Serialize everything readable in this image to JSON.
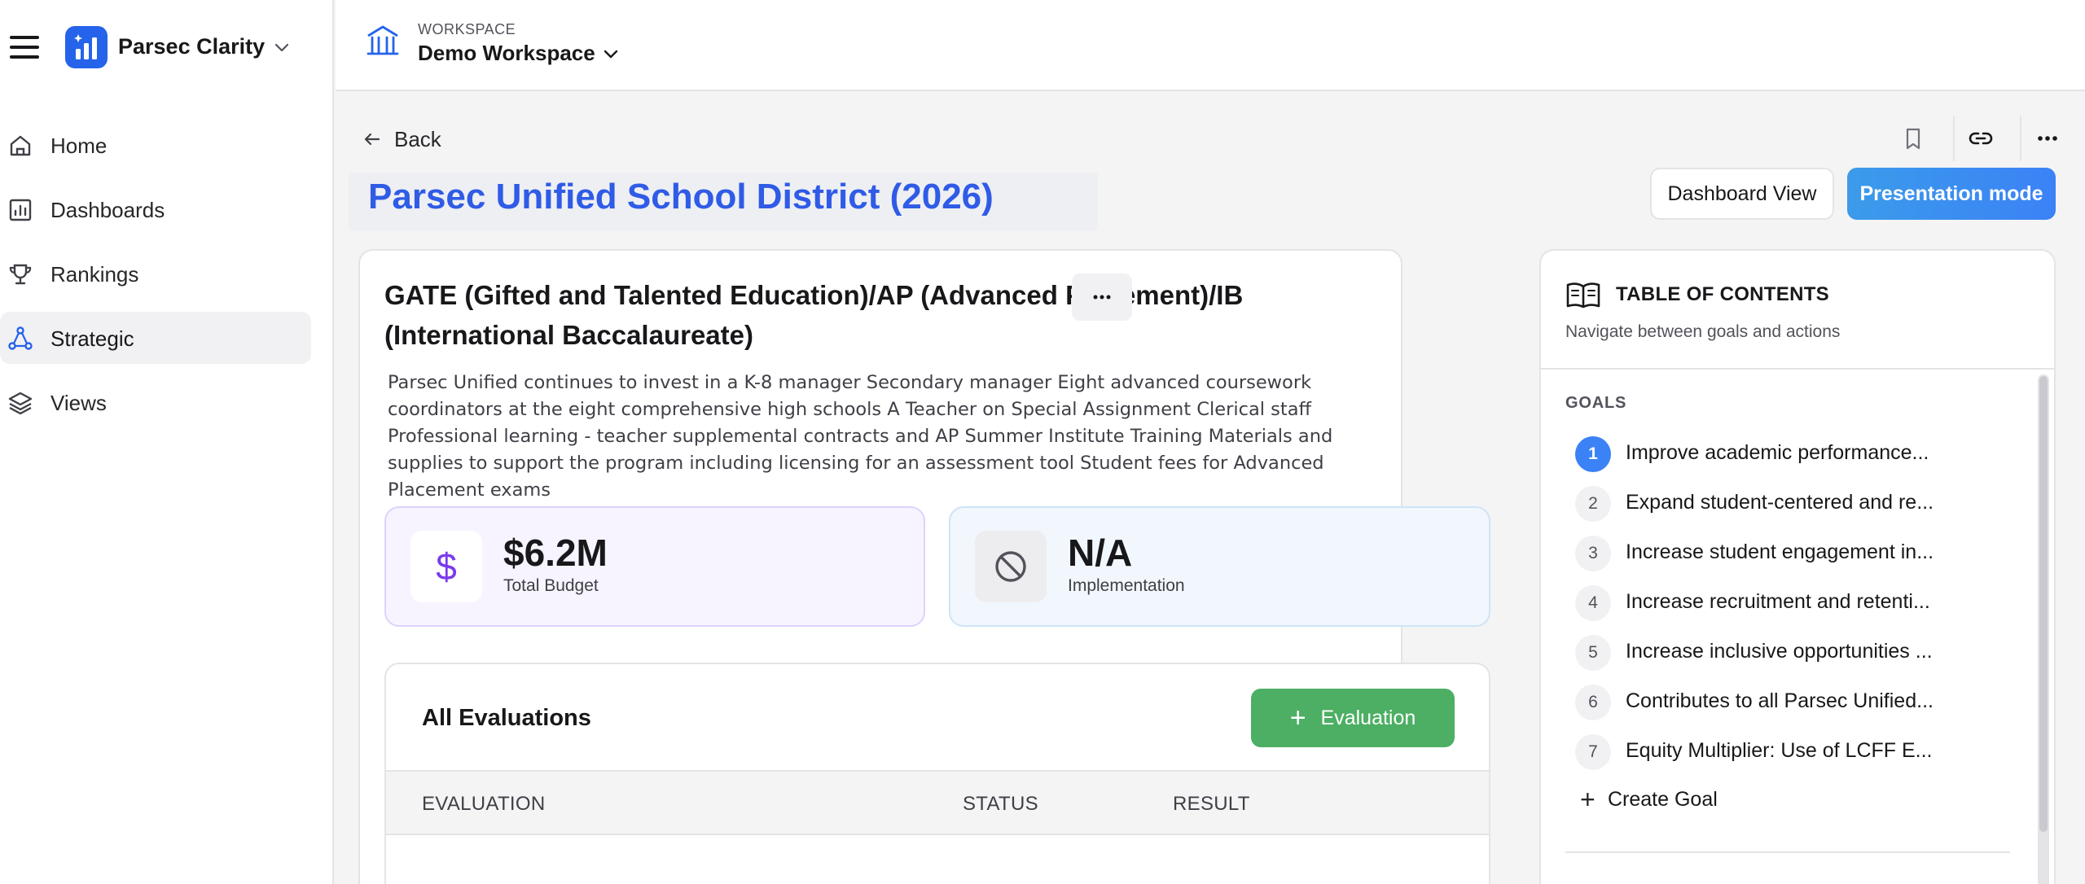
{
  "app": {
    "name": "Parsec Clarity"
  },
  "sidebar": {
    "items": [
      {
        "label": "Home",
        "icon": "home-icon"
      },
      {
        "label": "Dashboards",
        "icon": "dashboard-icon"
      },
      {
        "label": "Rankings",
        "icon": "trophy-icon"
      },
      {
        "label": "Strategic",
        "icon": "strategic-icon",
        "active": true
      },
      {
        "label": "Views",
        "icon": "layers-icon"
      }
    ]
  },
  "workspace": {
    "caption": "WORKSPACE",
    "name": "Demo Workspace"
  },
  "nav": {
    "back_label": "Back"
  },
  "page": {
    "title": "Parsec Unified School District (2026)",
    "dashboard_view_label": "Dashboard View",
    "presentation_mode_label": "Presentation mode"
  },
  "action": {
    "title": "GATE (Gifted and Talented Education)/AP (Advanced Placement)/IB (International Baccalaureate)",
    "description": "Parsec Unified continues to invest in a K-8 manager Secondary manager Eight advanced coursework coordinators at the eight comprehensive high schools A Teacher on Special Assignment Clerical staff Professional learning - teacher supplemental contracts and AP Summer Institute Training Materials and supplies to support the program including licensing for an assessment tool Student fees for Advanced Placement exams",
    "budget": {
      "value": "$6.2M",
      "label": "Total Budget",
      "icon_glyph": "$"
    },
    "implementation": {
      "value": "N/A",
      "label": "Implementation"
    }
  },
  "evaluations": {
    "title": "All Evaluations",
    "add_label": "Evaluation",
    "columns": [
      "EVALUATION",
      "STATUS",
      "RESULT"
    ]
  },
  "toc": {
    "title": "TABLE OF CONTENTS",
    "subtitle": "Navigate between goals and actions",
    "goals_label": "GOALS",
    "goals": [
      {
        "num": "1",
        "label": "Improve academic performance...",
        "active": true
      },
      {
        "num": "2",
        "label": "Expand student-centered and re..."
      },
      {
        "num": "3",
        "label": "Increase student engagement in..."
      },
      {
        "num": "4",
        "label": "Increase recruitment and retenti..."
      },
      {
        "num": "5",
        "label": "Increase inclusive opportunities ..."
      },
      {
        "num": "6",
        "label": "Contributes to all Parsec Unified..."
      },
      {
        "num": "7",
        "label": "Equity Multiplier: Use of LCFF E..."
      }
    ],
    "create_goal_label": "Create Goal"
  },
  "colors": {
    "accent": "#2f5be6",
    "primary": "#3b82f6",
    "success": "#4caf63",
    "budget_accent": "#7c3aed"
  }
}
